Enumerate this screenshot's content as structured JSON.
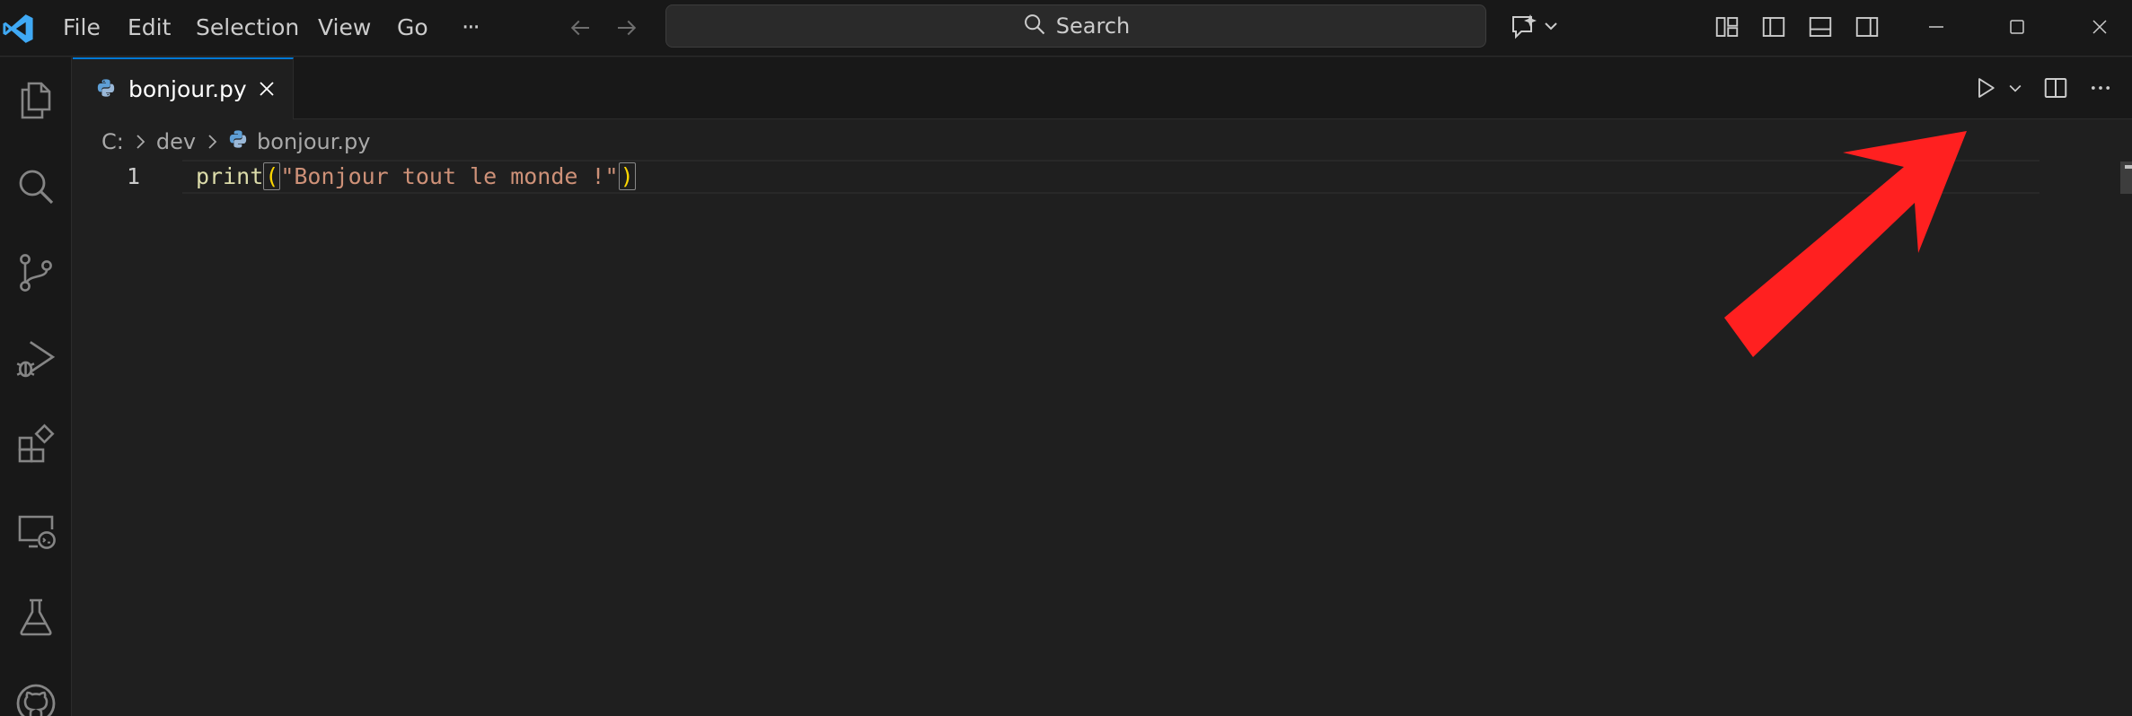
{
  "titlebar": {
    "menu": [
      "File",
      "Edit",
      "Selection",
      "View",
      "Go"
    ],
    "more_label": "···",
    "search_label": "Search"
  },
  "tabs": [
    {
      "label": "bonjour.py",
      "icon": "python-icon",
      "active": true
    }
  ],
  "breadcrumbs": [
    "C:",
    "dev",
    "bonjour.py"
  ],
  "editor": {
    "line_number": "1",
    "code": {
      "fn": "print",
      "open_paren": "(",
      "string": "\"Bonjour tout le monde !\"",
      "close_paren": ")"
    }
  },
  "icons": {
    "activity": [
      "explorer-icon",
      "search-icon",
      "source-control-icon",
      "run-debug-icon",
      "extensions-icon",
      "remote-explorer-icon",
      "testing-icon",
      "github-icon"
    ],
    "editor_actions": [
      "run-python-file-icon",
      "chevron-down-icon",
      "split-editor-icon",
      "more-actions-icon"
    ]
  },
  "colors": {
    "accent": "#0078d4",
    "annotation_arrow": "#ff2020",
    "function": "#dcdcaa",
    "string": "#ce9178",
    "bracket": "#ffd700"
  }
}
